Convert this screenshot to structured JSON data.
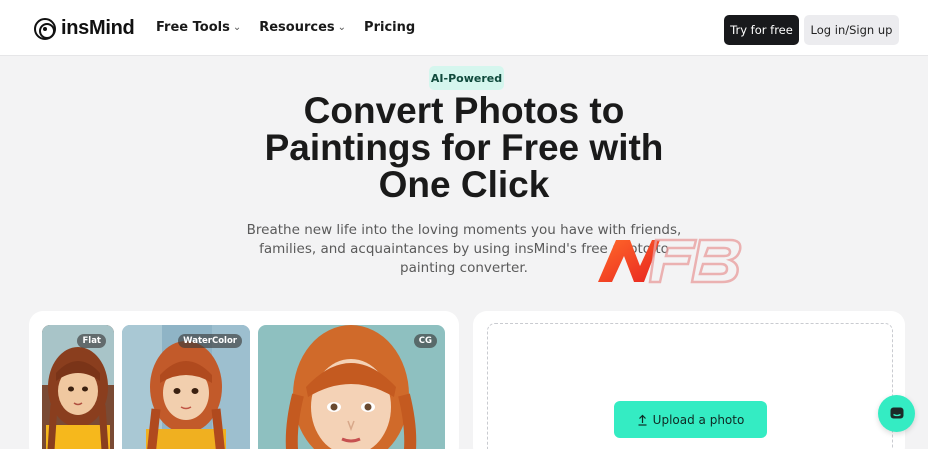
{
  "brand": {
    "name": "insMind"
  },
  "nav": {
    "links": [
      {
        "label": "Free Tools",
        "has_menu": true
      },
      {
        "label": "Resources",
        "has_menu": true
      },
      {
        "label": "Pricing",
        "has_menu": false
      }
    ],
    "try_label": "Try for free",
    "login_label": "Log in/Sign up"
  },
  "hero": {
    "badge": "AI-Powered",
    "title_lines": [
      "Convert Photos to",
      "Paintings for Free with",
      "One Click"
    ],
    "subtitle_lines": [
      "Breathe new life into the loving moments you have with friends,",
      "families, and acquaintances by using insMind's free photo to",
      "painting converter."
    ]
  },
  "styles": [
    {
      "tag": "Flat"
    },
    {
      "tag": "WaterColor"
    },
    {
      "tag": "CG"
    }
  ],
  "upload": {
    "label": "Upload a photo",
    "icon": "upload-icon"
  },
  "chat": {
    "icon": "chat-icon"
  },
  "colors": {
    "accent": "#34ecc3",
    "badge_bg": "#d5f6ee",
    "dark_button": "#18191c",
    "page_bg": "#f3f3f4"
  }
}
